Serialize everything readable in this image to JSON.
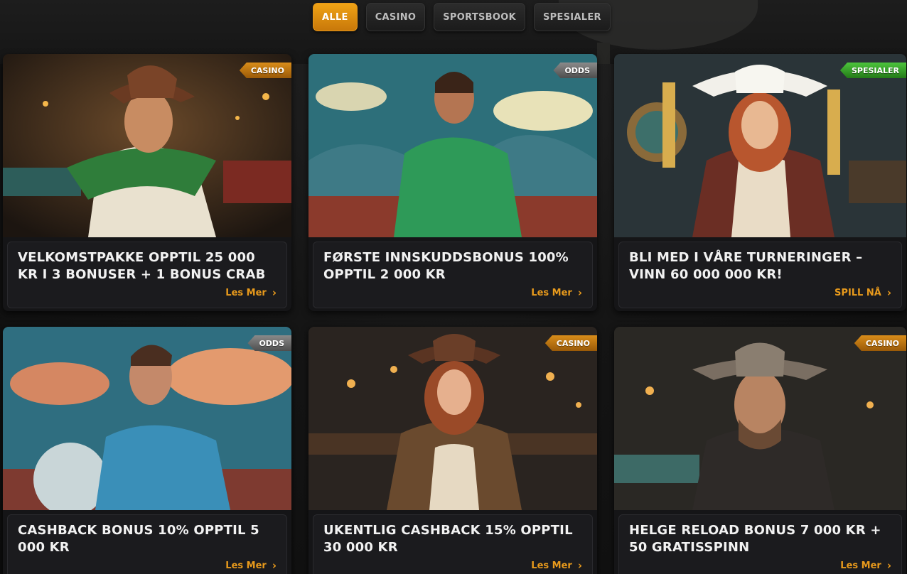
{
  "tabs": [
    {
      "label": "ALLE",
      "active": true
    },
    {
      "label": "CASINO",
      "active": false
    },
    {
      "label": "SPORTSBOOK",
      "active": false
    },
    {
      "label": "SPESIALER",
      "active": false
    }
  ],
  "cards": [
    {
      "badge": "CASINO",
      "badge_type": "casino",
      "title": "VELKOMSTPAKKE OPPTIL 25 000 KR I 3 BONUSER + 1 BONUS CRAB",
      "cta": "Les Mer",
      "art": "cowboy-green-scarf"
    },
    {
      "badge": "ODDS",
      "badge_type": "odds",
      "title": "FØRSTE INNSKUDDSBONUS 100% OPPTIL 2 000 KR",
      "cta": "Les Mer",
      "art": "footballer-green-shirt"
    },
    {
      "badge": "SPESIALER",
      "badge_type": "special",
      "title": "BLI MED I VÅRE TURNERINGER – VINN 60 000 000 KR!",
      "cta": "SPILL NÅ",
      "art": "cowgirl-revolvers"
    },
    {
      "badge": "ODDS",
      "badge_type": "odds",
      "title": "CASHBACK BONUS 10% OPPTIL 5 000 KR",
      "cta": "Les Mer",
      "art": "footballer-blue-shirt"
    },
    {
      "badge": "CASINO",
      "badge_type": "casino",
      "title": "UKENTLIG CASHBACK 15% OPPTIL 30 000 KR",
      "cta": "Les Mer",
      "art": "cowgirl-saloon"
    },
    {
      "badge": "CASINO",
      "badge_type": "casino",
      "title": "HELGE RELOAD BONUS 7 000 KR + 50 GRATISSPINN",
      "cta": "Les Mer",
      "art": "cowboy-pipe"
    }
  ],
  "colors": {
    "accent": "#e89a1c",
    "casino_ribbon": "#c37b12",
    "odds_ribbon": "#6d6d6d",
    "special_ribbon": "#3aa82c"
  }
}
